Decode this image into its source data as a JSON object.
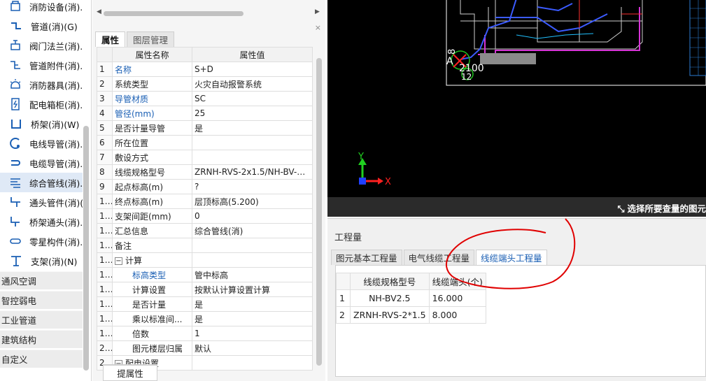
{
  "tree": {
    "items": [
      {
        "label": "消防设备(消).",
        "icon": "fire-equipment-icon"
      },
      {
        "label": "管道(消)(G)",
        "icon": "pipe-icon"
      },
      {
        "label": "阀门法兰(消).",
        "icon": "valve-flange-icon"
      },
      {
        "label": "管道附件(消).",
        "icon": "pipe-fitting-icon"
      },
      {
        "label": "消防器具(消).",
        "icon": "fire-alarm-device-icon"
      },
      {
        "label": "配电箱柜(消).",
        "icon": "distribution-box-icon"
      },
      {
        "label": "桥架(消)(W)",
        "icon": "cable-tray-icon"
      },
      {
        "label": "电线导管(消).",
        "icon": "wire-conduit-icon"
      },
      {
        "label": "电缆导管(消).",
        "icon": "cable-conduit-icon"
      },
      {
        "label": "综合管线(消).",
        "icon": "combined-pipeline-icon"
      },
      {
        "label": "通头管件(消)(",
        "icon": "tee-fitting-icon"
      },
      {
        "label": "桥架通头(消).",
        "icon": "tray-tee-icon"
      },
      {
        "label": "零星构件(消).",
        "icon": "misc-component-icon"
      },
      {
        "label": "支架(消)(N)",
        "icon": "support-bracket-icon"
      }
    ],
    "selected_index": 9,
    "categories": [
      "通风空调",
      "智控弱电",
      "工业管道",
      "建筑结构",
      "自定义"
    ]
  },
  "properties": {
    "tabs": [
      "属性",
      "图层管理"
    ],
    "active_tab": 0,
    "close_glyph": "×",
    "columns": [
      "属性名称",
      "属性值"
    ],
    "rows": [
      {
        "num": "1",
        "name": "名称",
        "value": "S+D",
        "blue": true
      },
      {
        "num": "2",
        "name": "系统类型",
        "value": "火灾自动报警系统"
      },
      {
        "num": "3",
        "name": "导管材质",
        "value": "SC",
        "blue": true
      },
      {
        "num": "4",
        "name": "管径(mm)",
        "value": "25",
        "blue": true
      },
      {
        "num": "5",
        "name": "是否计量导管",
        "value": "是"
      },
      {
        "num": "6",
        "name": "所在位置",
        "value": ""
      },
      {
        "num": "7",
        "name": "敷设方式",
        "value": ""
      },
      {
        "num": "8",
        "name": "线缆规格型号",
        "value": "ZRNH-RVS-2x1.5/NH-BV-2..."
      },
      {
        "num": "9",
        "name": "起点标高(m)",
        "value": "?"
      },
      {
        "num": "10",
        "name": "终点标高(m)",
        "value": "层顶标高(5.200)"
      },
      {
        "num": "11",
        "name": "支架间距(mm)",
        "value": "0"
      },
      {
        "num": "12",
        "name": "汇总信息",
        "value": "综合管线(消)"
      },
      {
        "num": "13",
        "name": "备注",
        "value": ""
      },
      {
        "num": "14",
        "name": "计算",
        "value": "",
        "group": true
      },
      {
        "num": "15",
        "name": "标高类型",
        "value": "管中标高",
        "blue": true,
        "child": true
      },
      {
        "num": "16",
        "name": "计算设置",
        "value": "按默认计算设置计算",
        "child": true
      },
      {
        "num": "17",
        "name": "是否计量",
        "value": "是",
        "child": true
      },
      {
        "num": "18",
        "name": "乘以标准间...",
        "value": "是",
        "child": true
      },
      {
        "num": "19",
        "name": "倍数",
        "value": "1",
        "child": true
      },
      {
        "num": "20",
        "name": "图元楼层归属",
        "value": "默认",
        "child": true
      },
      {
        "num": "21",
        "name": "配电设置",
        "value": "",
        "group": true
      }
    ],
    "bottom_tab": "提属性"
  },
  "viewport": {
    "axis_x": "X",
    "axis_y": "Y",
    "cmd_prompt": "选择所要查量的图元",
    "labels": [
      "A",
      "8",
      "2100",
      "12"
    ]
  },
  "quantity": {
    "title": "工程量",
    "tabs": [
      "图元基本工程量",
      "电气线缆工程量",
      "线缆端头工程量"
    ],
    "active_tab": 2,
    "columns": [
      "线缆规格型号",
      "线缆端头(个)"
    ],
    "rows": [
      {
        "num": "1",
        "spec": "NH-BV2.5",
        "count": "16.000"
      },
      {
        "num": "2",
        "spec": "ZRNH-RVS-2*1.5",
        "count": "8.000"
      }
    ]
  },
  "colors": {
    "accent_blue": "#1a5fb4",
    "annotation_red": "#e00000",
    "cad_background": "#000000"
  }
}
